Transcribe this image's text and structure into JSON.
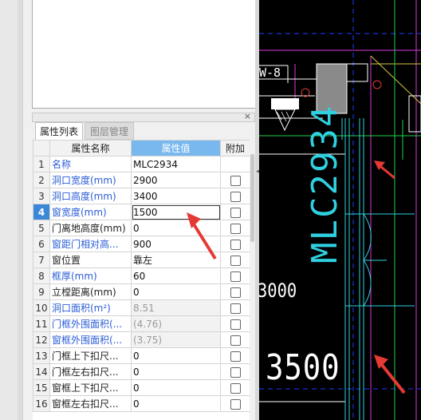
{
  "panel": {
    "tabs": [
      {
        "label": "属性列表",
        "active": true
      },
      {
        "label": "图层管理",
        "active": false
      }
    ],
    "close_label": "×",
    "headers": {
      "index": "",
      "name": "属性名称",
      "value": "属性值",
      "extra": "附加"
    },
    "rows": [
      {
        "idx": "1",
        "name": "名称",
        "value": "MLC2934",
        "blue": true,
        "checkbox": false
      },
      {
        "idx": "2",
        "name": "洞口宽度(mm)",
        "value": "2900",
        "blue": true,
        "checkbox": true
      },
      {
        "idx": "3",
        "name": "洞口高度(mm)",
        "value": "3400",
        "blue": true,
        "checkbox": true
      },
      {
        "idx": "4",
        "name": "窗宽度(mm)",
        "value": "1500",
        "blue": true,
        "checkbox": true,
        "selected": true
      },
      {
        "idx": "5",
        "name": "门离地高度(mm)",
        "value": "0",
        "blue": false,
        "checkbox": true
      },
      {
        "idx": "6",
        "name": "窗距门相对高...",
        "value": "900",
        "blue": true,
        "checkbox": true
      },
      {
        "idx": "7",
        "name": "窗位置",
        "value": "靠左",
        "blue": false,
        "checkbox": true
      },
      {
        "idx": "8",
        "name": "框厚(mm)",
        "value": "60",
        "blue": true,
        "checkbox": true
      },
      {
        "idx": "9",
        "name": "立樘距离(mm)",
        "value": "0",
        "blue": false,
        "checkbox": true
      },
      {
        "idx": "10",
        "name": "洞口面积(m²)",
        "value": "8.51",
        "blue": true,
        "checkbox": true,
        "gray": true
      },
      {
        "idx": "11",
        "name": "门框外围面积(...",
        "value": "(4.76)",
        "blue": true,
        "checkbox": true,
        "gray": true
      },
      {
        "idx": "12",
        "name": "窗框外围面积(...",
        "value": "(3.75)",
        "blue": true,
        "checkbox": true,
        "gray": true
      },
      {
        "idx": "13",
        "name": "门框上下扣尺...",
        "value": "0",
        "blue": false,
        "checkbox": true
      },
      {
        "idx": "14",
        "name": "门框左右扣尺...",
        "value": "0",
        "blue": false,
        "checkbox": true
      },
      {
        "idx": "15",
        "name": "窗框上下扣尺...",
        "value": "0",
        "blue": false,
        "checkbox": true
      },
      {
        "idx": "16",
        "name": "窗框左右扣尺...",
        "value": "0",
        "blue": false,
        "checkbox": true
      }
    ]
  },
  "cad": {
    "label_w8": "W-8",
    "label_3000": "3000",
    "label_3500": "3500",
    "label_mlc": "MLC2934"
  },
  "colors": {
    "selected_row": "#3b88d8",
    "header_value": "#79b8ee",
    "blue_text": "#2a5cd6",
    "annotation_red": "#e53935",
    "cad_cyan": "#2fd0e0",
    "cad_green": "#22d04a"
  },
  "icons": [
    "close-icon",
    "checkbox-icon",
    "arrow-annotation-icon",
    "splitter-arrow-icon"
  ]
}
